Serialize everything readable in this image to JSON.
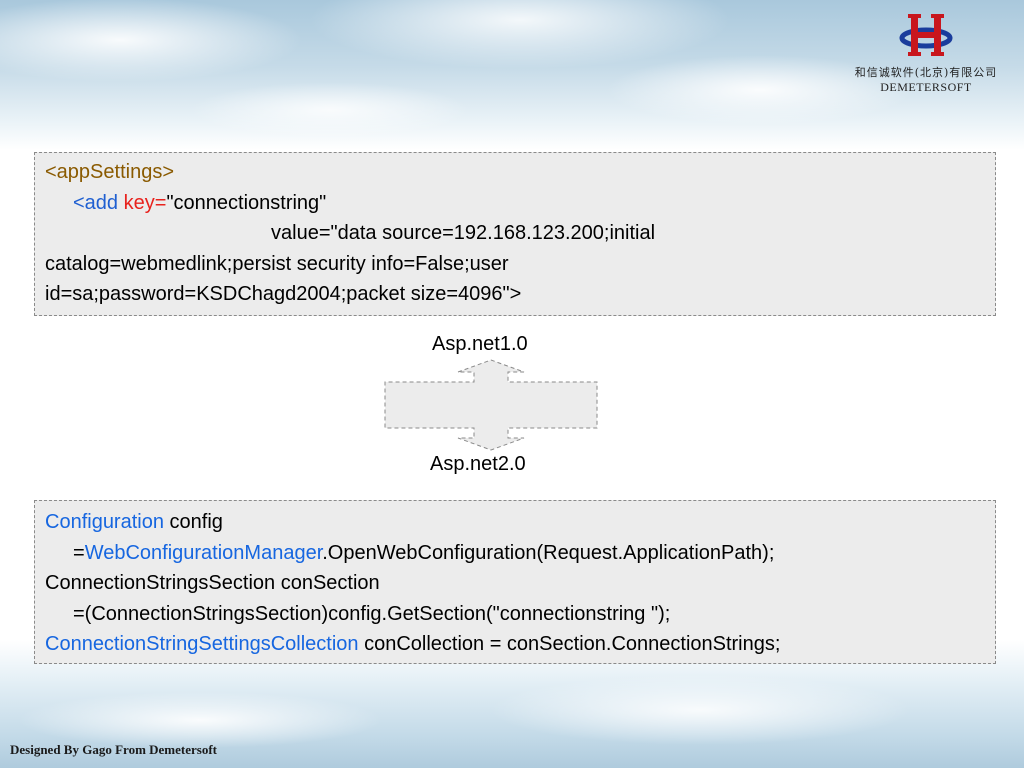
{
  "logo": {
    "company_cn": "和信诚软件(北京)有限公司",
    "company_en": "DEMETERSOFT",
    "colors": {
      "red": "#c8161d",
      "blue": "#1a3c9c"
    }
  },
  "box1": {
    "tag_open": "<appSettings>",
    "add_open": "<add",
    "key_attr": "key=",
    "key_value": "\"connectionstring\"",
    "value_line": "value=\"data source=192.168.123.200;initial",
    "line3": "catalog=webmedlink;persist security info=False;user",
    "line4": "id=sa;password=KSDChagd2004;packet size=4096\">"
  },
  "transition": {
    "top_label": "Asp.net1.0",
    "bottom_label": "Asp.net2.0"
  },
  "box2": {
    "l1_type": "Configuration",
    "l1_rest": " config",
    "l2_prefix": "=",
    "l2_type": "WebConfigurationManager",
    "l2_rest": ".OpenWebConfiguration(Request.ApplicationPath);",
    "l3": "ConnectionStringsSection conSection",
    "l4": "=(ConnectionStringsSection)config.GetSection(\"connectionstring \");",
    "l5_type": "ConnectionStringSettingsCollection",
    "l5_rest": " conCollection = conSection.ConnectionStrings;"
  },
  "footer": {
    "text": "Designed By Gago From Demetersoft"
  }
}
